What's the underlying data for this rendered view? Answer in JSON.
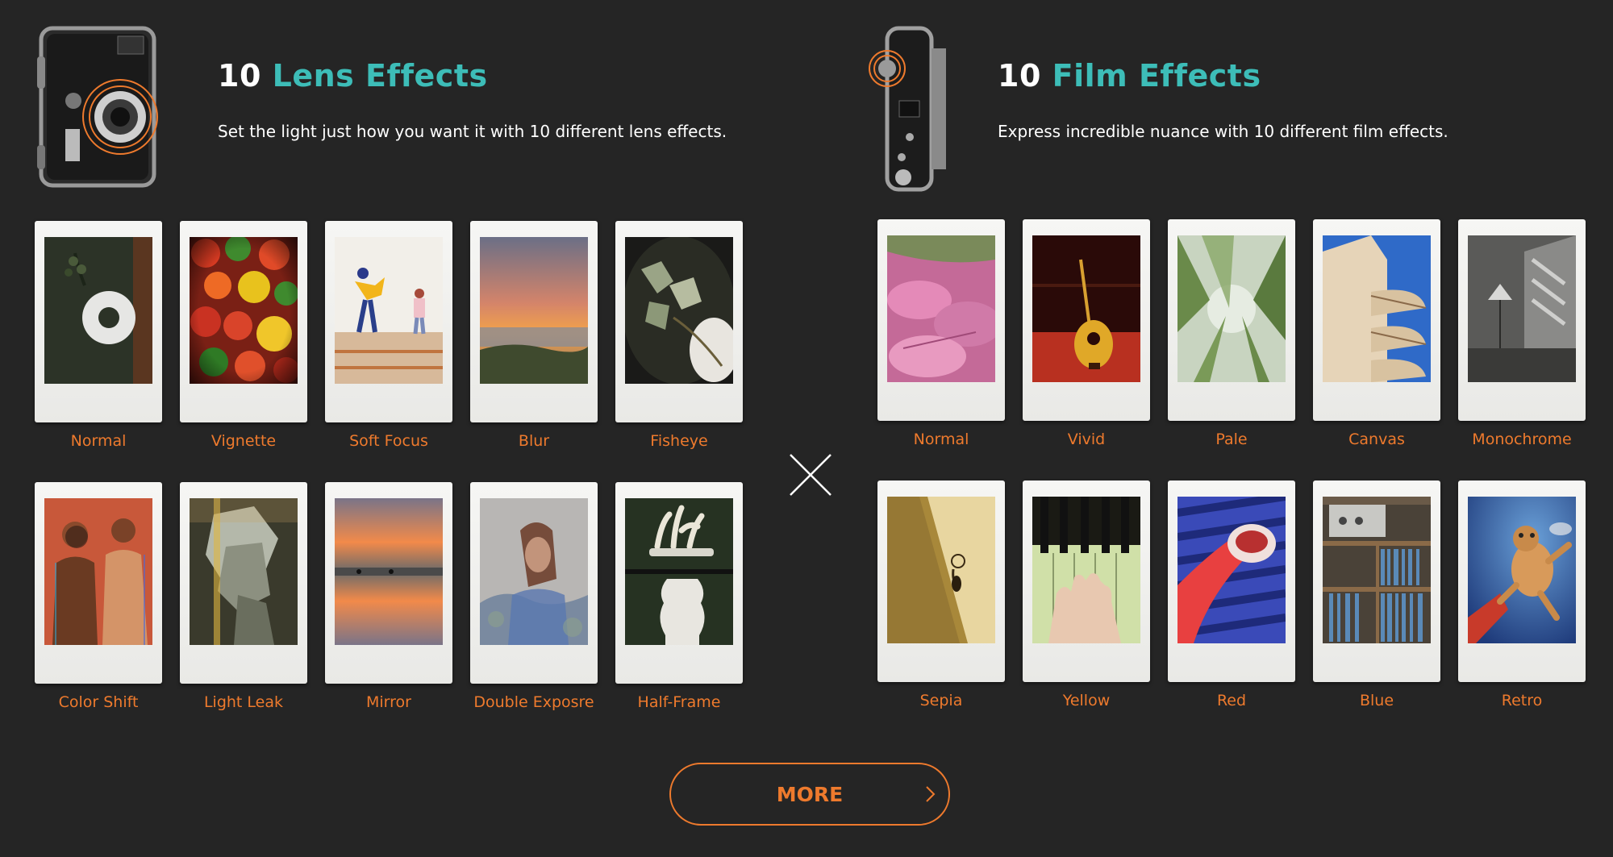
{
  "lens": {
    "count": "10",
    "title_accent": "Lens Effects",
    "description": "Set the light just how you want it with 10 different lens effects.",
    "effects": [
      {
        "label": "Normal"
      },
      {
        "label": "Vignette"
      },
      {
        "label": "Soft Focus"
      },
      {
        "label": "Blur"
      },
      {
        "label": "Fisheye"
      },
      {
        "label": "Color Shift"
      },
      {
        "label": "Light Leak"
      },
      {
        "label": "Mirror"
      },
      {
        "label": "Double Exposre"
      },
      {
        "label": "Half-Frame"
      }
    ]
  },
  "film": {
    "count": "10",
    "title_accent": "Film Effects",
    "description": "Express incredible nuance with 10 different film effects.",
    "effects": [
      {
        "label": "Normal"
      },
      {
        "label": "Vivid"
      },
      {
        "label": "Pale"
      },
      {
        "label": "Canvas"
      },
      {
        "label": "Monochrome"
      },
      {
        "label": "Sepia"
      },
      {
        "label": "Yellow"
      },
      {
        "label": "Red"
      },
      {
        "label": "Blue"
      },
      {
        "label": "Retro"
      }
    ]
  },
  "more_button": {
    "label": "MORE"
  },
  "colors": {
    "accent_teal": "#3dbdb8",
    "accent_orange": "#ee7a2d",
    "background": "#252525"
  }
}
